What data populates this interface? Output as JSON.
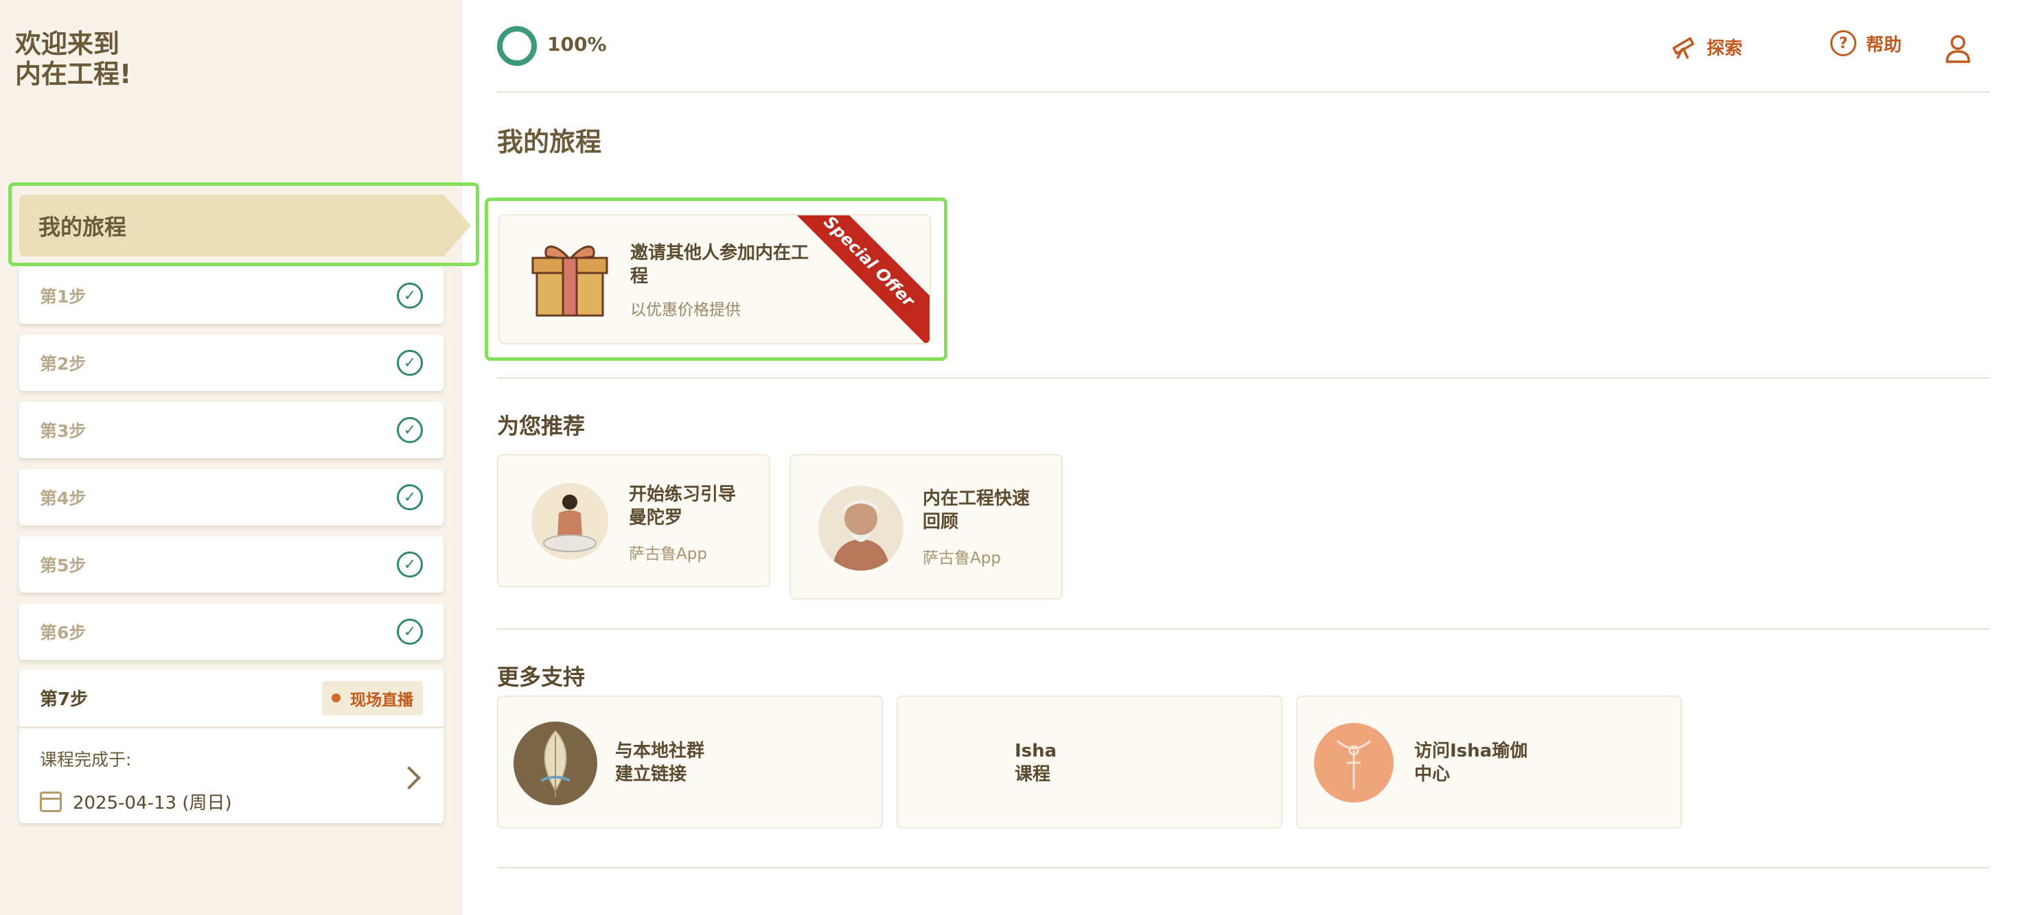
{
  "sidebar": {
    "welcome_line1": "欢迎来到",
    "welcome_line2": "内在工程!",
    "journey_label": "我的旅程",
    "steps": [
      {
        "label": "第1步"
      },
      {
        "label": "第2步"
      },
      {
        "label": "第3步"
      },
      {
        "label": "第4步"
      },
      {
        "label": "第5步"
      },
      {
        "label": "第6步"
      }
    ],
    "step7": {
      "label": "第7步",
      "badge": "现场直播",
      "completion_label": "课程完成于:",
      "completion_date": "2025-04-13 (周日)"
    }
  },
  "header": {
    "progress": "100%",
    "explore": "探索",
    "help": "帮助"
  },
  "main": {
    "title": "我的旅程",
    "offer": {
      "title": "邀请其他人参加内在工程",
      "subtitle": "以优惠价格提供",
      "ribbon": "Special Offer"
    },
    "recommend": {
      "heading": "为您推荐",
      "cards": [
        {
          "title_line1": "开始练习引导",
          "title_line2": "曼陀罗",
          "subtitle": "萨古鲁App"
        },
        {
          "title_line1": "内在工程快速",
          "title_line2": "回顾",
          "subtitle": "萨古鲁App"
        }
      ]
    },
    "support": {
      "heading": "更多支持",
      "cards": [
        {
          "title_line1": "与本地社群",
          "title_line2": "建立链接"
        },
        {
          "title_line1": "Isha",
          "title_line2": "课程"
        },
        {
          "title_line1": "访问Isha瑜伽",
          "title_line2": "中心"
        }
      ]
    }
  },
  "colors": {
    "accent": "#c25a1e",
    "check_green": "#2e8a6a",
    "highlight": "#84e05a",
    "ribbon_red": "#c0281e",
    "sidebar_bg": "#f7f3ea"
  }
}
